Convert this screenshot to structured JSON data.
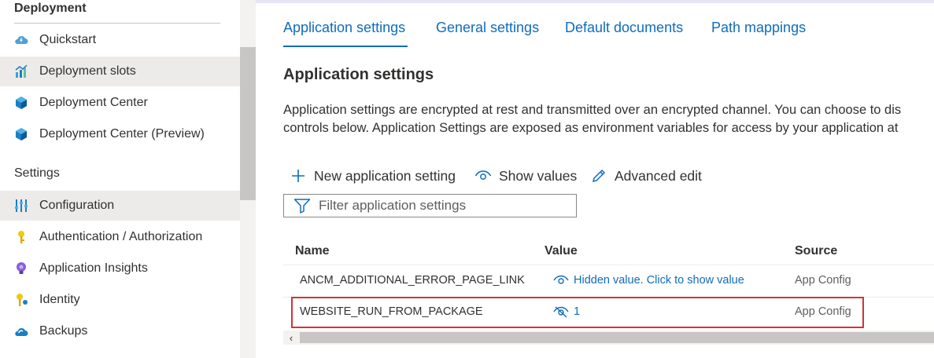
{
  "sidebar": {
    "sections": [
      {
        "title": "Deployment"
      },
      {
        "title": "Settings"
      }
    ],
    "deployment_items": [
      {
        "label": "Quickstart",
        "icon": "cloud-bolt-icon"
      },
      {
        "label": "Deployment slots",
        "icon": "slots-chart-icon"
      },
      {
        "label": "Deployment Center",
        "icon": "cube-icon"
      },
      {
        "label": "Deployment Center (Preview)",
        "icon": "cube-icon"
      }
    ],
    "settings_items": [
      {
        "label": "Configuration",
        "icon": "sliders-icon",
        "selected": true
      },
      {
        "label": "Authentication / Authorization",
        "icon": "key-icon"
      },
      {
        "label": "Application Insights",
        "icon": "lightbulb-icon"
      },
      {
        "label": "Identity",
        "icon": "identity-key-icon"
      },
      {
        "label": "Backups",
        "icon": "cloud-backup-icon"
      }
    ]
  },
  "tabs": [
    {
      "label": "Application settings",
      "active": true
    },
    {
      "label": "General settings"
    },
    {
      "label": "Default documents"
    },
    {
      "label": "Path mappings"
    }
  ],
  "main": {
    "heading": "Application settings",
    "description_line1": "Application settings are encrypted at rest and transmitted over an encrypted channel. You can choose to dis",
    "description_line2": "controls below. Application Settings are exposed as environment variables for access by your application at"
  },
  "commands": {
    "new_setting": "New application setting",
    "show_values": "Show values",
    "advanced_edit": "Advanced edit"
  },
  "filter": {
    "placeholder": "Filter application settings"
  },
  "table": {
    "headers": {
      "name": "Name",
      "value": "Value",
      "source": "Source"
    },
    "rows": [
      {
        "name": "ANCM_ADDITIONAL_ERROR_PAGE_LINK",
        "value": "Hidden value. Click to show value",
        "source": "App Config"
      },
      {
        "name": "WEBSITE_RUN_FROM_PACKAGE",
        "value": "1",
        "source": "App Config"
      }
    ]
  },
  "colors": {
    "accent": "#0f6cbd",
    "highlight": "#d13438",
    "selected_bg": "#edebe9"
  }
}
